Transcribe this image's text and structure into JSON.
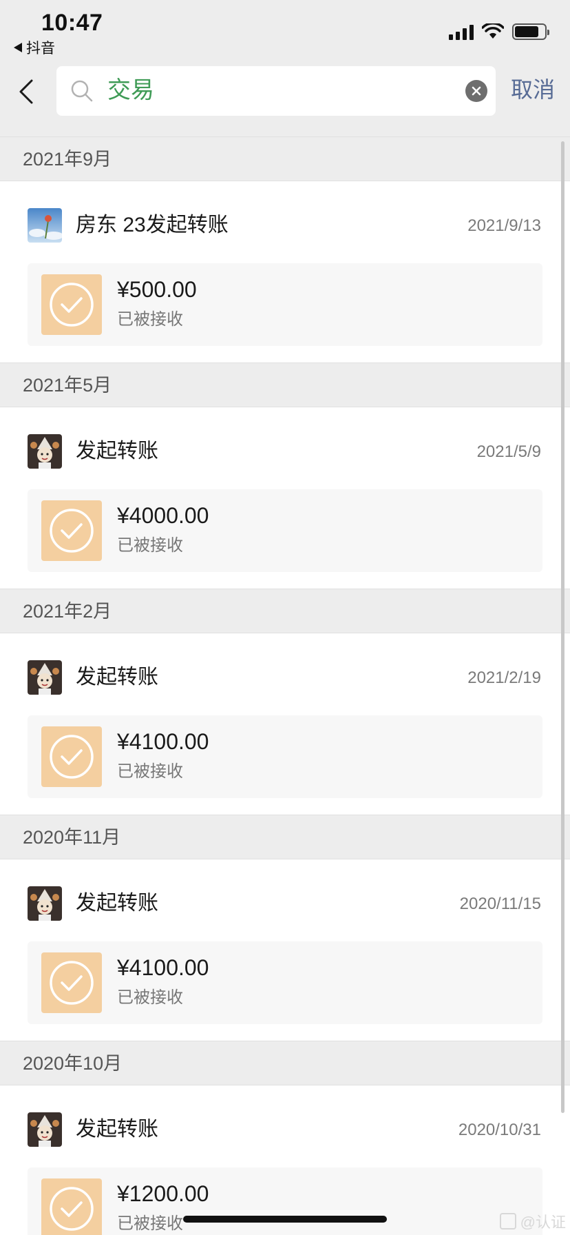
{
  "status_bar": {
    "time": "10:47",
    "back_app": "抖音"
  },
  "search": {
    "query": "交易",
    "cancel_label": "取消"
  },
  "groups": [
    {
      "month": "2021年9月",
      "entry": {
        "title": "房东 23发起转账",
        "date": "2021/9/13",
        "amount": "¥500.00",
        "status": "已被接收",
        "avatar": "flower-photo"
      }
    },
    {
      "month": "2021年5月",
      "entry": {
        "title": "发起转账",
        "date": "2021/5/9",
        "amount": "¥4000.00",
        "status": "已被接收",
        "avatar": "cartoon-character"
      }
    },
    {
      "month": "2021年2月",
      "entry": {
        "title": "发起转账",
        "date": "2021/2/19",
        "amount": "¥4100.00",
        "status": "已被接收",
        "avatar": "cartoon-character"
      }
    },
    {
      "month": "2020年11月",
      "entry": {
        "title": "发起转账",
        "date": "2020/11/15",
        "amount": "¥4100.00",
        "status": "已被接收",
        "avatar": "cartoon-character"
      }
    },
    {
      "month": "2020年10月",
      "entry": {
        "title": "发起转账",
        "date": "2020/10/31",
        "amount": "¥1200.00",
        "status": "已被接收",
        "avatar": "cartoon-character"
      }
    }
  ],
  "watermark": "@认证",
  "colors": {
    "accent_green": "#3f9b56",
    "link_blue": "#576b95",
    "badge_orange": "#f4cfa0"
  }
}
